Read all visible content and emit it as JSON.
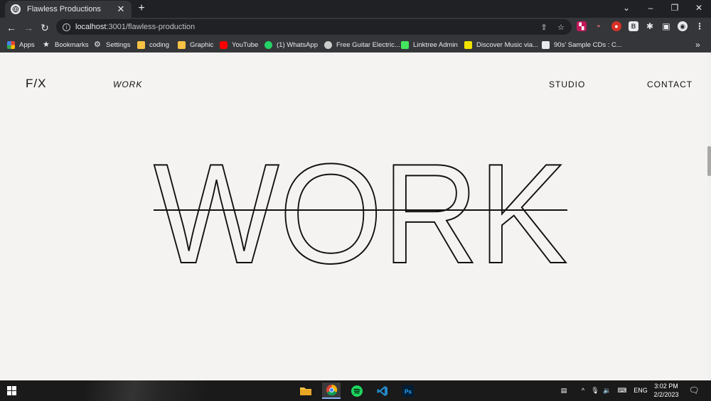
{
  "browser": {
    "tab_title": "Flawless Productions",
    "url_host": "localhost",
    "url_rest": ":3001/flawless-production"
  },
  "bookmarks": [
    {
      "label": "Apps",
      "icon": "apps-grid-icon",
      "color": "#ea4335"
    },
    {
      "label": "Bookmarks",
      "icon": "star-icon",
      "color": "#e8eaed"
    },
    {
      "label": "Settings",
      "icon": "gear-icon",
      "color": "#e8eaed"
    },
    {
      "label": "coding",
      "icon": "folder-icon",
      "color": "#f6c343"
    },
    {
      "label": "Graphic",
      "icon": "folder-icon",
      "color": "#f6c343"
    },
    {
      "label": "YouTube",
      "icon": "youtube-icon",
      "color": "#ff0000"
    },
    {
      "label": "(1) WhatsApp",
      "icon": "whatsapp-icon",
      "color": "#25d366"
    },
    {
      "label": "Free Guitar Electric...",
      "icon": "guitar-site-icon",
      "color": "#cccccc"
    },
    {
      "label": "Linktree Admin",
      "icon": "linktree-icon",
      "color": "#43e55e"
    },
    {
      "label": "Discover Music via...",
      "icon": "music-site-icon",
      "color": "#f2e300"
    },
    {
      "label": "90s' Sample CDs : C...",
      "icon": "cd-site-icon",
      "color": "#e8eaed"
    }
  ],
  "site": {
    "logo": "F/X",
    "nav_work": "WORK",
    "nav_studio": "STUDIO",
    "nav_contact": "CONTACT",
    "hero_word": "WORK"
  },
  "taskbar": {
    "language": "ENG",
    "time": "3:02 PM",
    "date": "2/2/2023"
  },
  "colors": {
    "page_bg": "#f4f3f1",
    "ink": "#111111",
    "chrome_dark": "#202124",
    "chrome_mid": "#35363a"
  }
}
